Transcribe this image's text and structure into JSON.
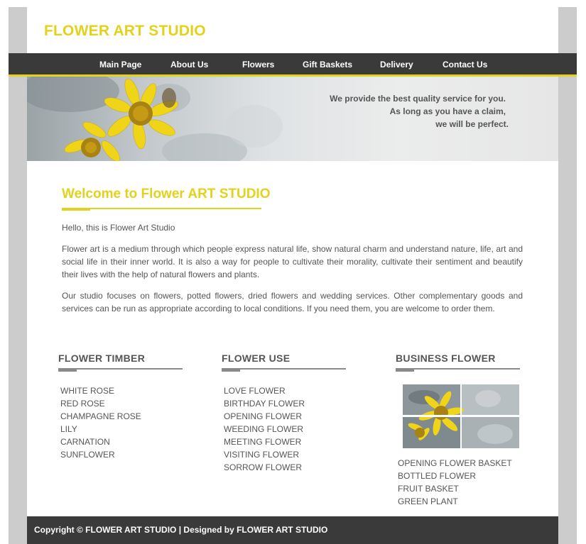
{
  "site": {
    "logo": "FLOWER ART STUDIO"
  },
  "nav": {
    "items": [
      "Main Page",
      "About Us",
      "Flowers",
      "Gift Baskets",
      "Delivery",
      "Contact Us"
    ]
  },
  "banner": {
    "taglines": [
      "We provide the best quality service for you.",
      "As long as you have a claim,",
      "we will be perfect."
    ]
  },
  "welcome": {
    "title": "Welcome to Flower ART STUDIO",
    "greeting": "Hello, this is Flower Art Studio",
    "paragraphs": [
      "Flower art is a medium through which people express natural life, show natural charm and understand nature, life, art and social life in their inner world. It is also a way for people to cultivate their morality, cultivate their sentiment and beautify their lives with the help of natural flowers and plants.",
      "Our studio focuses on flowers, potted flowers, dried flowers and wedding services. Other complementary goods and services can be run as appropriate according to local conditions. If you need them, you are welcome to order them."
    ]
  },
  "columns": [
    {
      "title": "FLOWER TIMBER",
      "items": [
        "WHITE ROSE",
        "RED ROSE",
        "CHAMPAGNE ROSE",
        "LILY",
        "CARNATION",
        "SUNFLOWER"
      ]
    },
    {
      "title": "FLOWER USE",
      "items": [
        "LOVE FLOWER",
        "BIRTHDAY FLOWER",
        "OPENING FLOWER",
        "WEEDING FLOWER",
        "MEETING FLOWER",
        "VISITING FLOWER",
        "SORROW FLOWER"
      ]
    },
    {
      "title": "BUSINESS FLOWER",
      "items": [
        "OPENING FLOWER BASKET",
        "BOTTLED FLOWER",
        "FRUIT BASKET",
        "GREEN PLANT"
      ]
    }
  ],
  "footer": {
    "text": "Copyright © FLOWER ART STUDIO | Designed by FLOWER ART STUDIO"
  },
  "colors": {
    "accent": "#e3d21c",
    "dark": "#3a3a3a",
    "text": "#555555",
    "rule": "#8a8a8a"
  }
}
